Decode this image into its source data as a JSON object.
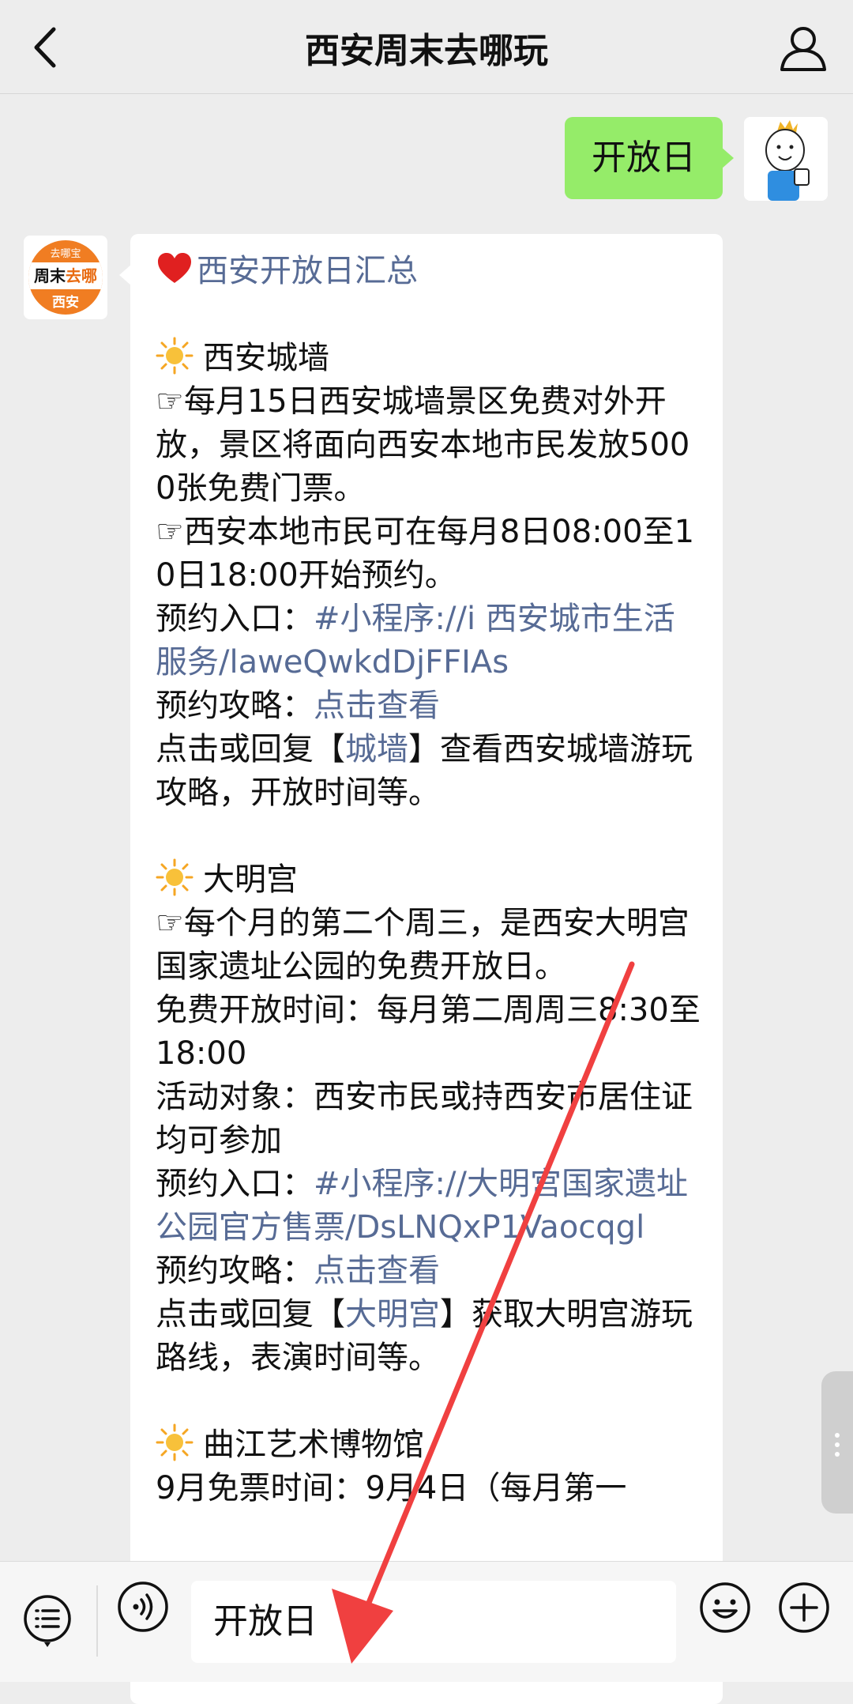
{
  "header": {
    "title": "西安周末去哪玩"
  },
  "outgoing": {
    "text": "开放日"
  },
  "bot_avatar": {
    "top": "去哪宝",
    "line1": "周末",
    "line1b": "去哪",
    "line2": "西安"
  },
  "message": {
    "title": "西安开放日汇总",
    "s1_heading": "西安城墙",
    "s1_p1": "☞每月15日西安城墙景区免费对外开放，景区将面向西安本地市民发放5000张免费门票。",
    "s1_p2": "☞西安本地市民可在每月8日08:00至10日18:00开始预约。",
    "s1_entry_label": "预约入口：",
    "s1_entry_link": "#小程序://i 西安城市生活服务/laweQwkdDjFFIAs",
    "s1_guide_label": "预约攻略：",
    "s1_guide_link": "点击查看",
    "s1_reply_pre": "点击或回复【",
    "s1_reply_link": "城墙",
    "s1_reply_post": "】查看西安城墙游玩攻略，开放时间等。",
    "s2_heading": "大明宫",
    "s2_p1": "☞每个月的第二个周三，是西安大明宫国家遗址公园的免费开放日。",
    "s2_p2": "免费开放时间：每月第二周周三8:30至18:00",
    "s2_p3": "活动对象：西安市民或持西安市居住证均可参加",
    "s2_entry_label": "预约入口：",
    "s2_entry_link": "#小程序://大明宫国家遗址公园官方售票/DsLNQxP1Vaocqgl",
    "s2_guide_label": "预约攻略：",
    "s2_guide_link": "点击查看",
    "s2_reply_pre": "点击或回复【",
    "s2_reply_link": "大明宫",
    "s2_reply_post": "】获取大明宫游玩路线，表演时间等。",
    "s3_heading": "曲江艺术博物馆",
    "s3_p1": "9月免票时间：9月4日（每月第一"
  },
  "input": {
    "value": "开放日"
  },
  "colors": {
    "link": "#576b95",
    "outgoing_bubble": "#95ec69",
    "arrow": "#f04040"
  }
}
